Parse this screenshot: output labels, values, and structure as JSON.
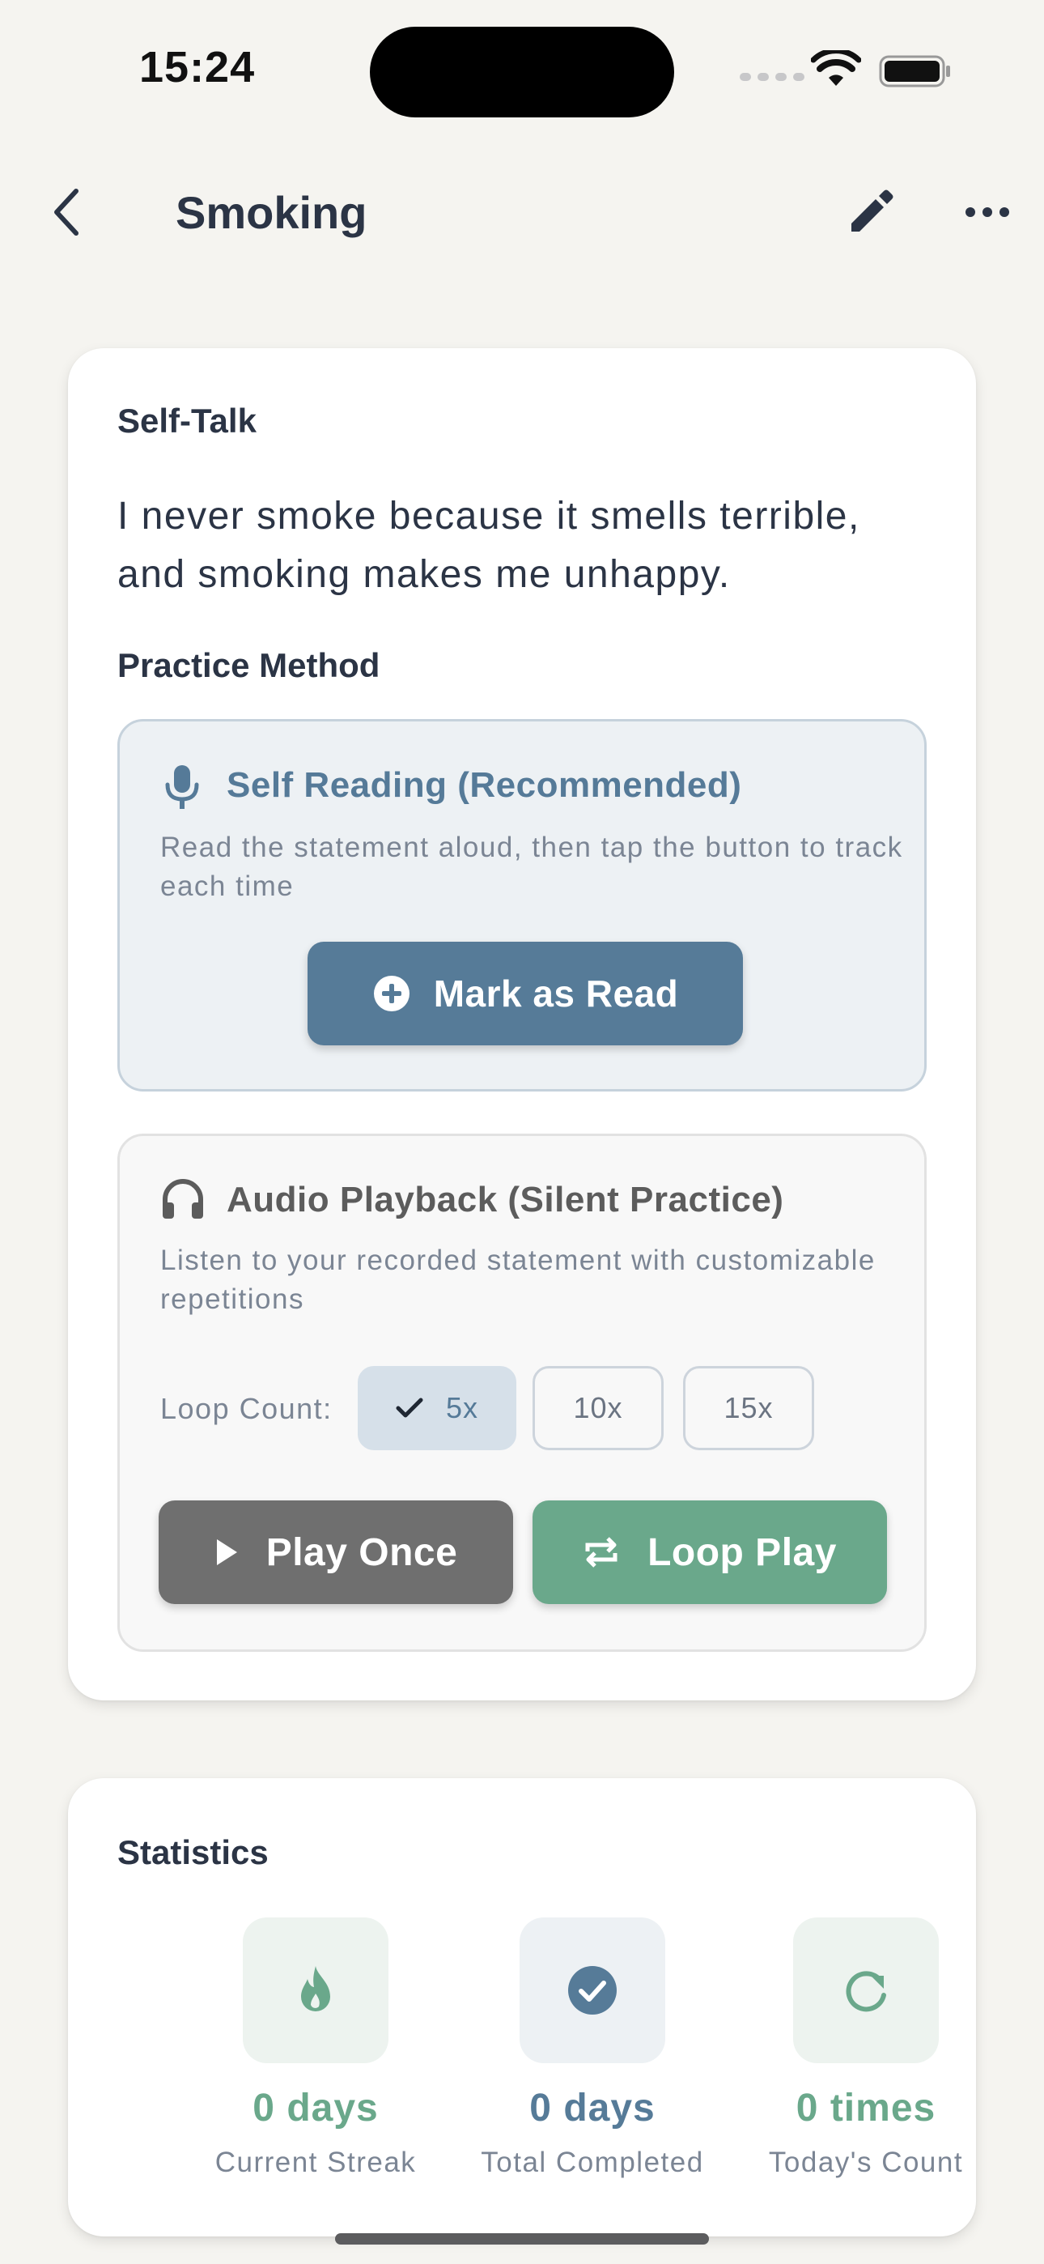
{
  "status_bar": {
    "time": "15:24"
  },
  "nav": {
    "title": "Smoking"
  },
  "self_talk": {
    "label": "Self-Talk",
    "statement": "I never smoke because it smells terrible, and smoking makes me unhappy."
  },
  "practice": {
    "label": "Practice Method",
    "self_reading": {
      "title": "Self Reading (Recommended)",
      "description": "Read the statement aloud, then tap the button to track each time",
      "button_label": "Mark as Read"
    },
    "audio": {
      "title": "Audio Playback (Silent Practice)",
      "description": "Listen to your recorded statement with customizable repetitions",
      "loop_label": "Loop Count:",
      "loop_options": [
        "5x",
        "10x",
        "15x"
      ],
      "selected_loop": "5x",
      "play_once_label": "Play Once",
      "loop_play_label": "Loop Play"
    }
  },
  "statistics": {
    "label": "Statistics",
    "items": [
      {
        "value": "0 days",
        "caption": "Current Streak",
        "icon": "flame-icon",
        "color": "#6aa88b"
      },
      {
        "value": "0 days",
        "caption": "Total Completed",
        "icon": "check-circle-icon",
        "color": "#567b98"
      },
      {
        "value": "0 times",
        "caption": "Today's Count",
        "icon": "refresh-icon",
        "color": "#6aa88b"
      }
    ]
  },
  "colors": {
    "background": "#f5f4f0",
    "primary_blue": "#567b98",
    "green": "#6aa88b",
    "gray_button": "#6f6f6f"
  }
}
